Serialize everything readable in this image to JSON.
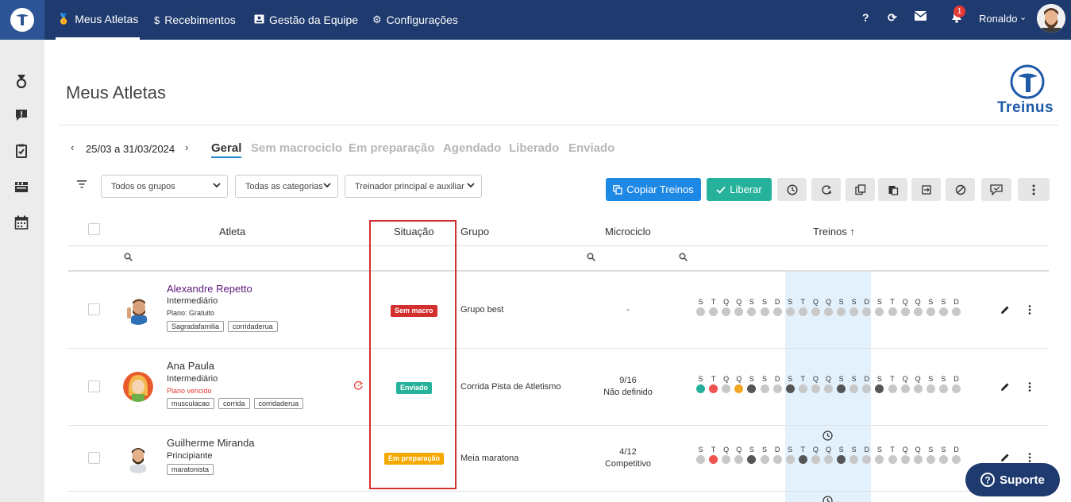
{
  "topbar": {
    "nav": [
      {
        "label": "Meus Atletas",
        "icon": "medal-icon",
        "active": true
      },
      {
        "label": "Recebimentos",
        "icon": "dollar-icon"
      },
      {
        "label": "Gestão da Equipe",
        "icon": "id-card-icon"
      },
      {
        "label": "Configurações",
        "icon": "gears-icon"
      }
    ],
    "help_label": "?",
    "notifications_count": "1",
    "user_name": "Ronaldo"
  },
  "page": {
    "title": "Meus Atletas",
    "brand": "Treinus"
  },
  "date_nav": {
    "range": "25/03 a 31/03/2024"
  },
  "tabs": [
    {
      "label": "Geral",
      "active": true
    },
    {
      "label": "Sem macrociclo"
    },
    {
      "label": "Em preparação"
    },
    {
      "label": "Agendado"
    },
    {
      "label": "Liberado"
    },
    {
      "label": "Enviado"
    }
  ],
  "filters": {
    "groups": "Todos os grupos",
    "categories": "Todas as categorias",
    "coach": "Treinador principal e auxiliar"
  },
  "actions": {
    "copy": "Copiar Treinos",
    "release": "Liberar"
  },
  "table": {
    "headers": {
      "athlete": "Atleta",
      "status": "Situação",
      "group": "Grupo",
      "microcycle": "Microciclo",
      "trainings": "Treinos ↑"
    },
    "day_letters": [
      "S",
      "T",
      "Q",
      "Q",
      "S",
      "S",
      "D",
      "S",
      "T",
      "Q",
      "Q",
      "S",
      "S",
      "D",
      "S",
      "T",
      "Q",
      "Q",
      "S",
      "S",
      "D"
    ],
    "rows": [
      {
        "name": "Alexandre Repetto",
        "level": "Intermediário",
        "plan": "Plano: Gratuito",
        "tags": [
          "Sagradafamilia",
          "corridaderua"
        ],
        "status": "Sem macro",
        "status_color": "#d32f2f",
        "group": "Grupo best",
        "micro_line1": "-",
        "micro_line2": "",
        "dots": [
          "#c8c8c8",
          "#c8c8c8",
          "#c8c8c8",
          "#c8c8c8",
          "#c8c8c8",
          "#c8c8c8",
          "#c8c8c8",
          "#c8c8c8",
          "#c8c8c8",
          "#c8c8c8",
          "#c8c8c8",
          "#c8c8c8",
          "#c8c8c8",
          "#c8c8c8",
          "#c8c8c8",
          "#c8c8c8",
          "#c8c8c8",
          "#c8c8c8",
          "#c8c8c8",
          "#c8c8c8",
          "#c8c8c8"
        ]
      },
      {
        "name": "Ana Paula",
        "level": "Intermediário",
        "plan": "Plano vencido",
        "tags": [
          "musculacao",
          "corrida",
          "corridaderua"
        ],
        "status": "Enviado",
        "status_color": "#26b29a",
        "group": "Corrida Pista de Atletismo",
        "micro_line1": "9/16",
        "micro_line2": "Não definido",
        "dots": [
          "#26b29a",
          "#ef5350",
          "#c8c8c8",
          "#f5a623",
          "#555555",
          "#c8c8c8",
          "#c8c8c8",
          "#555555",
          "#c8c8c8",
          "#c8c8c8",
          "#c8c8c8",
          "#555555",
          "#c8c8c8",
          "#c8c8c8",
          "#555555",
          "#c8c8c8",
          "#c8c8c8",
          "#c8c8c8",
          "#c8c8c8",
          "#c8c8c8",
          "#c8c8c8"
        ]
      },
      {
        "name": "Guilherme Miranda",
        "level": "Principiante",
        "plan": "",
        "tags": [
          "maratonista"
        ],
        "status": "Em preparação",
        "status_color": "#f5a800",
        "group": "Meia maratona",
        "micro_line1": "4/12",
        "micro_line2": "Competitivo",
        "dots": [
          "#c8c8c8",
          "#ef5350",
          "#c8c8c8",
          "#c8c8c8",
          "#555555",
          "#c8c8c8",
          "#c8c8c8",
          "#c8c8c8",
          "#555555",
          "#c8c8c8",
          "#c8c8c8",
          "#555555",
          "#c8c8c8",
          "#c8c8c8",
          "#c8c8c8",
          "#c8c8c8",
          "#c8c8c8",
          "#c8c8c8",
          "#c8c8c8",
          "#c8c8c8",
          "#c8c8c8"
        ]
      }
    ]
  },
  "support": {
    "label": "Suporte"
  }
}
